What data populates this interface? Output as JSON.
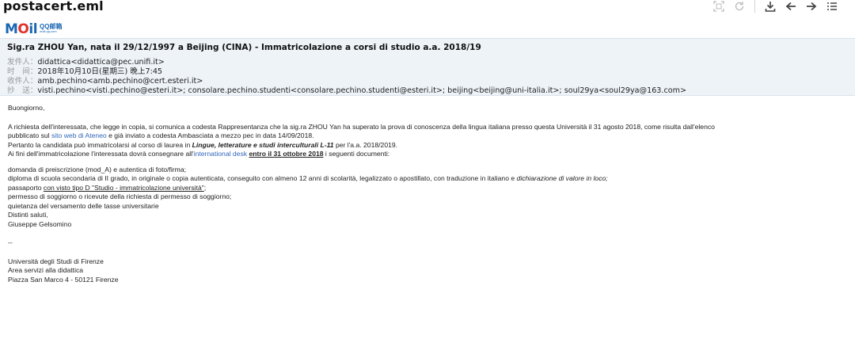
{
  "file_title": "postacert.eml",
  "logo": {
    "main": "MOil",
    "sub_a": "QQ邮箱",
    "sub_b": "mail.qq.com"
  },
  "toolbar": {
    "icons": [
      "fullscreen-icon",
      "refresh-icon",
      "download-icon",
      "back-arrow-icon",
      "forward-arrow-icon",
      "menu-icon"
    ]
  },
  "email": {
    "subject": "Sig.ra ZHOU Yan, nata il 29/12/1997 a Beijing (CINA) - Immatricolazione a corsi di studio a.a. 2018/19",
    "from": {
      "label": "发件人：",
      "value": "didattica<didattica@pec.unifi.it>"
    },
    "time": {
      "label": "时　间：",
      "value": "2018年10月10日(星期三) 晚上7:45"
    },
    "to": {
      "label": "收件人：",
      "value": "amb.pechino<amb.pechino@cert.esteri.it>"
    },
    "cc": {
      "label": "抄　送：",
      "value": "visti.pechino<visti.pechino@esteri.it>; consolare.pechino.studenti<consolare.pechino.studenti@esteri.it>; beijing<beijing@uni-italia.it>; soul29ya<soul29ya@163.com>"
    }
  },
  "body": {
    "greeting": "Buongiorno,",
    "p1_a": "A richiesta dell'interessata, che legge in copia, si comunica a codesta Rappresentanza che la sig.ra ZHOU Yan ha superato la prova di conoscenza della lingua italiana presso questa Università il 31 agosto 2018, come risulta dall'elenco",
    "p1_b_pre": "pubblicato sul ",
    "p1_b_link": "sito web di Ateneo",
    "p1_b_post": " e già inviato a codesta Ambasciata a mezzo pec in data 14/09/2018.",
    "p2_pre": "Pertanto la candidata può immatricolarsi al corso di laurea in ",
    "p2_bold": "Lingue, letterature e studi interculturali L-11",
    "p2_post": " per l'a.a. 2018/2019.",
    "p3_pre": "Ai fini dell'immatricolazione l'interessata dovrà consegnare all'",
    "p3_link": "international desk",
    "p3_space": " ",
    "p3_bold": "entro il 31 ottobre 2018",
    "p3_post": " i seguenti documenti:",
    "doc1": "domanda di preiscrizione (mod_A) e autentica di foto/firma;",
    "doc2_pre": "diploma di scuola secondaria di II grado, in originale o copia autenticata, conseguito con almeno 12 anni di scolarità, legalizzato o apostillato, con traduzione in italiano e ",
    "doc2_ital": "dichiarazione di valore in loco;",
    "doc3_pre": "passaporto ",
    "doc3_link": "con visto tipo D \"Studio - immatricolazione università\"",
    "doc3_post": ";",
    "doc4": "permesso di soggiorno o ricevute della richiesta di permesso di soggiorno;",
    "doc5": "quietanza del versamento delle tasse universitarie",
    "closing": "Distinti saluti,",
    "signer": "Giuseppe Gelsomino",
    "sep": "--",
    "sig1": "Università degli Studi di Firenze",
    "sig2": "Area servizi alla didattica",
    "sig3": "Piazza San Marco 4 - 50121 Firenze"
  },
  "colors": {
    "header_bg": "#eef3f8",
    "link": "#3366bb",
    "logo_blue": "#1a66b3",
    "logo_red": "#e0322d"
  }
}
